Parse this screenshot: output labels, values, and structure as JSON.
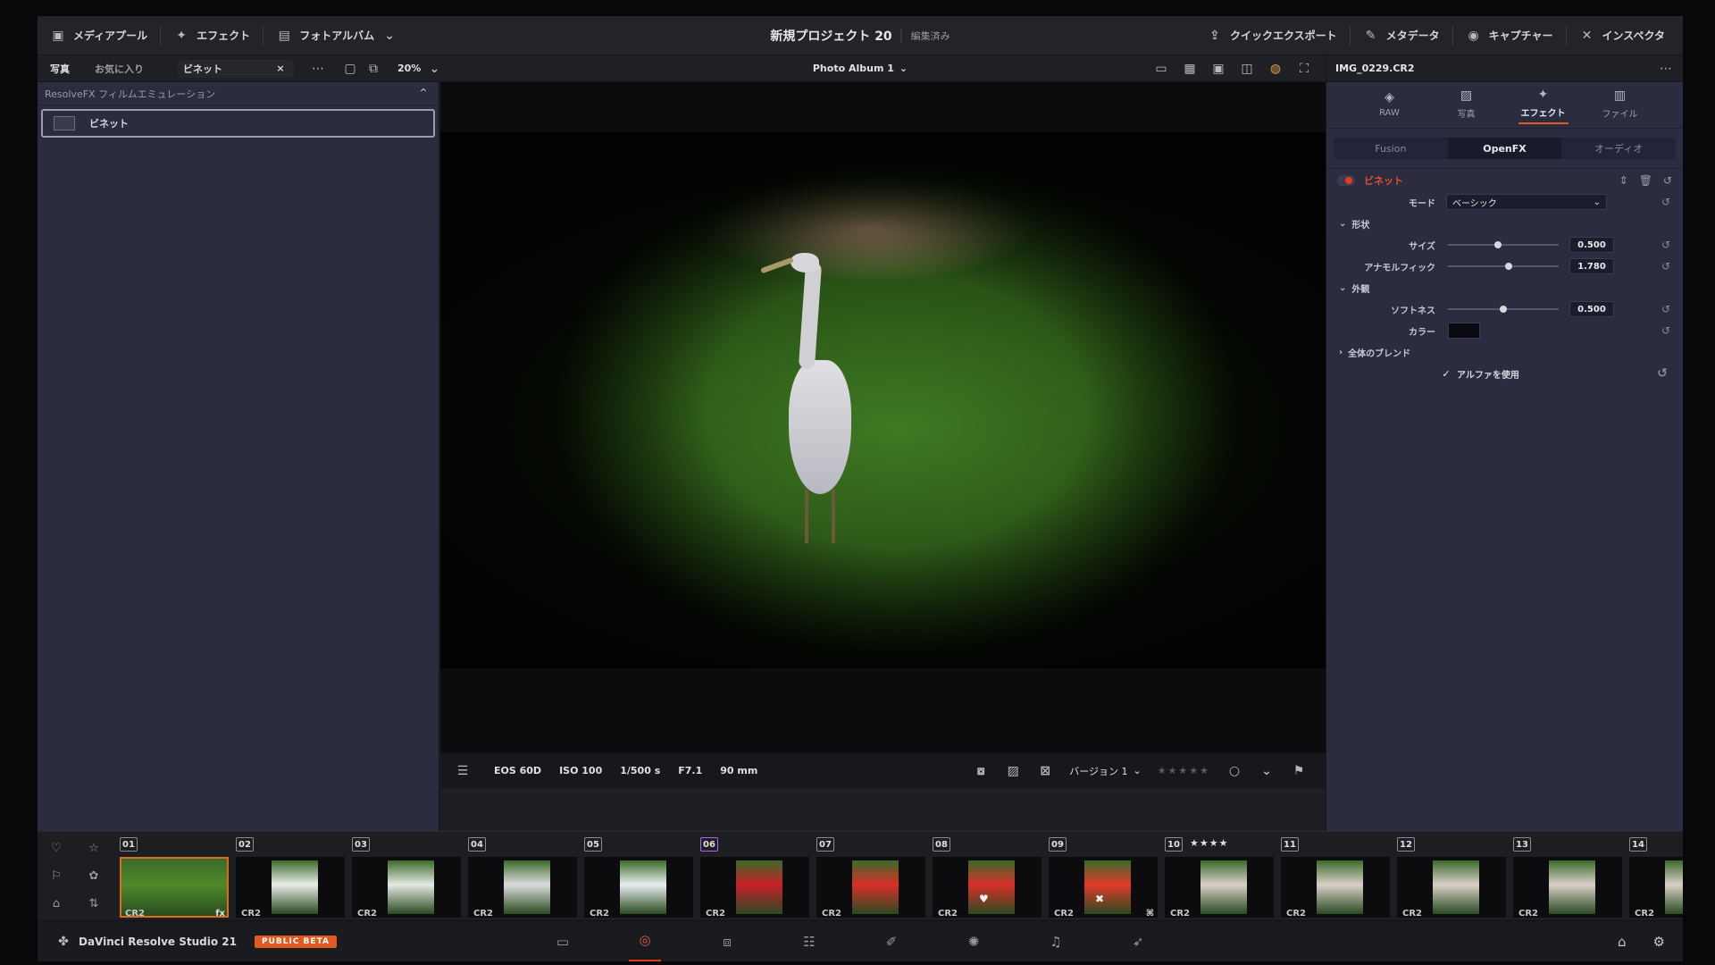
{
  "topbar": {
    "media_pool": "メディアプール",
    "effects": "エフェクト",
    "photo_album": "フォトアルバム",
    "project_title": "新規プロジェクト 20",
    "project_status": "編集済み",
    "quick_export": "クイックエクスポート",
    "metadata": "メタデータ",
    "capture": "キャプチャー",
    "inspector": "インスペクタ"
  },
  "subbar": {
    "tab_photos": "写真",
    "tab_favorites": "お気に入り",
    "search_value": "ビネット",
    "zoom": "20%",
    "album": "Photo Album 1",
    "file_name": "IMG_0229.CR2"
  },
  "left_panel": {
    "category": "ResolveFX フィルムエミュレーション",
    "item": "ビネット"
  },
  "viewer_bar": {
    "camera": "EOS 60D",
    "iso": "ISO 100",
    "shutter": "1/500 s",
    "aperture": "F7.1",
    "focal": "90 mm",
    "version": "バージョン 1",
    "rating": "★★★★★"
  },
  "inspector": {
    "tabs": [
      "RAW",
      "写真",
      "エフェクト",
      "ファイル"
    ],
    "seg": [
      "Fusion",
      "OpenFX",
      "オーディオ"
    ],
    "effect_name": "ビネット",
    "mode_label": "モード",
    "mode_value": "ベーシック",
    "section_shape": "形状",
    "size_label": "サイズ",
    "size_value": "0.500",
    "size_level": 0.45,
    "anamorphic_label": "アナモルフィック",
    "anamorphic_value": "1.780",
    "anamorphic_level": 0.55,
    "section_look": "外観",
    "softness_label": "ソフトネス",
    "softness_value": "0.500",
    "softness_level": 0.5,
    "color_label": "カラー",
    "color_value": "#0a0a10",
    "section_blend": "全体のブレンド",
    "use_alpha": "アルファを使用"
  },
  "filmstrip": {
    "clips": [
      {
        "num": "01",
        "type": "CR2",
        "badge": "fx",
        "color": "#4f8a2a"
      },
      {
        "num": "02",
        "type": "CR2",
        "color": "#e8ece8"
      },
      {
        "num": "03",
        "type": "CR2",
        "color": "#e4e8e2"
      },
      {
        "num": "04",
        "type": "CR2",
        "color": "#dcdcdc"
      },
      {
        "num": "05",
        "type": "CR2",
        "color": "#e8eef0"
      },
      {
        "num": "06",
        "type": "CR2",
        "color": "#c8202a"
      },
      {
        "num": "07",
        "type": "CR2",
        "color": "#d8302a"
      },
      {
        "num": "08",
        "type": "CR2",
        "mark": "♥",
        "color": "#d8302a"
      },
      {
        "num": "09",
        "type": "CR2",
        "mark": "✖",
        "badge": "⌘",
        "color": "#e03a2a"
      },
      {
        "num": "10",
        "type": "CR2",
        "stars": "★★★★",
        "color": "#d8d0c8"
      },
      {
        "num": "11",
        "type": "CR2",
        "color": "#d8d0c8"
      },
      {
        "num": "12",
        "type": "CR2",
        "color": "#d8d0c8"
      },
      {
        "num": "13",
        "type": "CR2",
        "color": "#d8d0c8"
      },
      {
        "num": "14",
        "type": "CR2",
        "color": "#d8d0c8"
      }
    ]
  },
  "bottombar": {
    "brand": "DaVinci Resolve Studio 21",
    "beta": "PUBLIC BETA"
  },
  "colors": {
    "accent": "#e05a20",
    "effect_red": "#e84a2a",
    "panel": "#2b2c40"
  }
}
